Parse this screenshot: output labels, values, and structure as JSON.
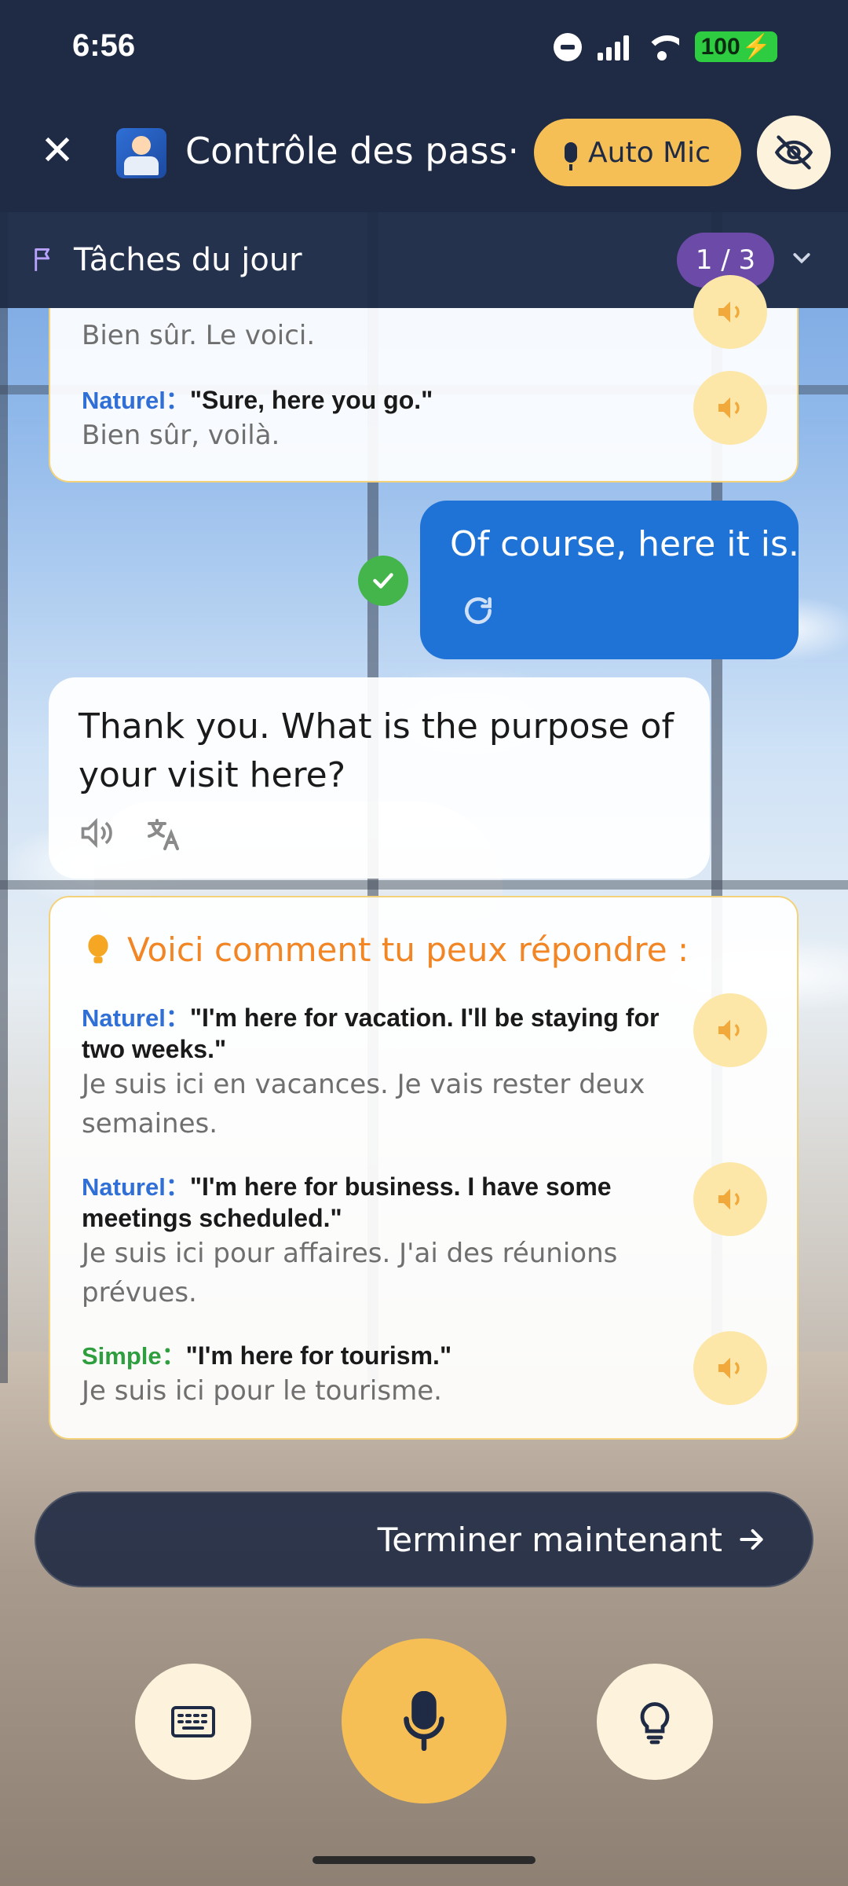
{
  "status_bar": {
    "time": "6:56",
    "battery": "100"
  },
  "header": {
    "title": "Contrôle des pass···",
    "auto_mic_label": "Auto Mic"
  },
  "tasks": {
    "label": "Tâches du jour",
    "count": "1 / 3"
  },
  "previous_suggestions": {
    "items": [
      {
        "fr": "Bien sûr. Le voici."
      },
      {
        "tag": "Naturel：",
        "en": "\"Sure, here you go.\"",
        "fr": "Bien sûr, voilà."
      }
    ]
  },
  "user_message": {
    "text": "Of course, here it is."
  },
  "ai_message": {
    "text": "Thank you. What is the purpose of your visit here?"
  },
  "suggestions": {
    "title": "Voici comment tu peux répondre :",
    "items": [
      {
        "tag": "Naturel：",
        "en": "\"I'm here for vacation. I'll be staying for two weeks.\"",
        "fr": "Je suis ici en vacances. Je vais rester deux semaines."
      },
      {
        "tag": "Naturel：",
        "en": "\"I'm here for business. I have some meetings scheduled.\"",
        "fr": "Je suis ici pour affaires. J'ai des réunions prévues."
      },
      {
        "tag": "Simple：",
        "en": "\"I'm here for tourism.\"",
        "fr": "Je suis ici pour le tourisme."
      }
    ]
  },
  "finish_button": {
    "label": "Terminer maintenant"
  },
  "colors": {
    "header_bg": "#1f2a44",
    "accent_yellow": "#f5bf55",
    "user_bubble": "#1f73d6",
    "tip_title": "#f28524",
    "natural_tag": "#2f6fd6",
    "simple_tag": "#2e9e3e",
    "task_badge": "#6b4aa8"
  },
  "icons": [
    "close-icon",
    "scene-icon",
    "mic-icon",
    "eye-off-icon",
    "flag-icon",
    "chevron-down-icon",
    "speaker-icon",
    "check-icon",
    "retry-icon",
    "translate-icon",
    "lightbulb-icon",
    "arrow-right-icon",
    "keyboard-icon"
  ]
}
